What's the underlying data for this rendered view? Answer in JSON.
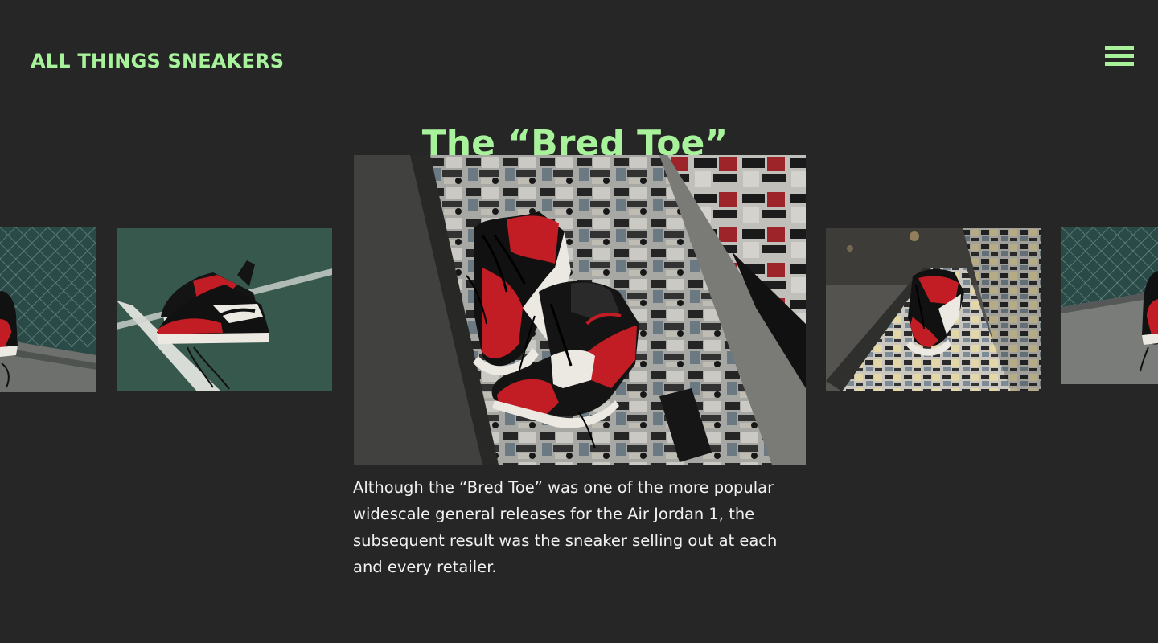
{
  "header": {
    "brand": "ALL THINGS SNEAKERS",
    "menu_icon": "hamburger-menu-icon"
  },
  "main": {
    "title": "The “Bred Toe”",
    "description": "Although the “Bred Toe” was one of the more popular widescale general releases for the Air Jordan 1, the subsequent result was the sneaker selling out at each and every retailer."
  },
  "carousel": {
    "active_index": 2,
    "slides": [
      {
        "subject": "sneaker-by-fence"
      },
      {
        "subject": "sneakers-on-court"
      },
      {
        "subject": "sneakers-on-sticker-bench"
      },
      {
        "subject": "sneaker-on-bench-street"
      },
      {
        "subject": "sneaker-by-fence-right"
      }
    ]
  },
  "colors": {
    "background": "#262626",
    "accent": "#a8f29b",
    "text": "#f1f1f1",
    "sneaker_red": "#c21d24",
    "sneaker_black": "#111111",
    "sneaker_white": "#ece8e2"
  }
}
